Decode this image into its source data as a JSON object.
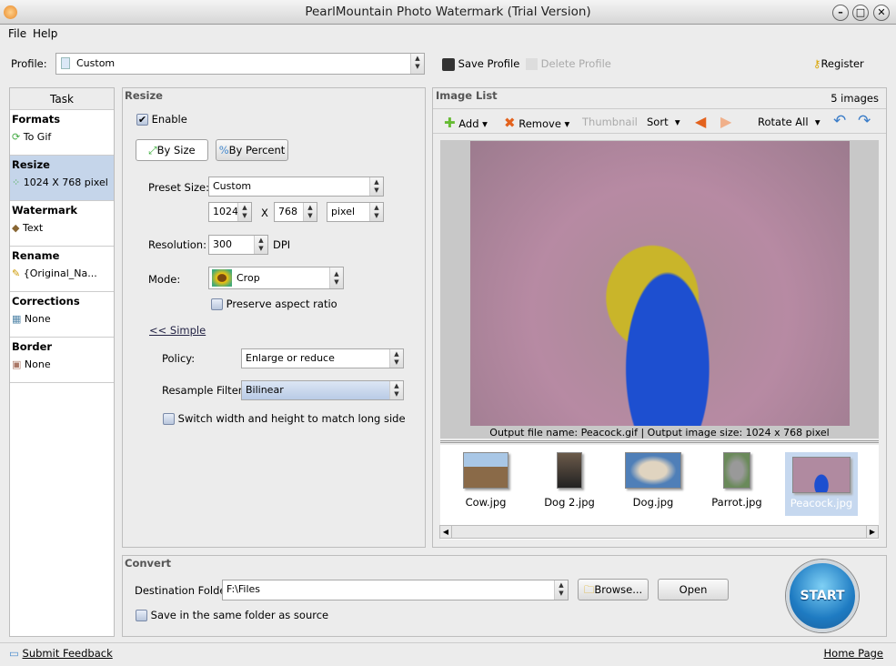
{
  "window": {
    "title": "PearlMountain Photo Watermark (Trial Version)"
  },
  "menu": [
    "File",
    "Help"
  ],
  "profile": {
    "label": "Profile:",
    "value": "Custom",
    "save": "Save Profile",
    "delete": "Delete Profile",
    "register": "Register"
  },
  "task": {
    "header": "Task",
    "sections": [
      {
        "title": "Formats",
        "value": "To Gif"
      },
      {
        "title": "Resize",
        "value": "1024 X 768 pixel"
      },
      {
        "title": "Watermark",
        "value": "Text"
      },
      {
        "title": "Rename",
        "value": "{Original_Na..."
      },
      {
        "title": "Corrections",
        "value": "None"
      },
      {
        "title": "Border",
        "value": "None"
      }
    ]
  },
  "resize": {
    "header": "Resize",
    "enable": "Enable",
    "by_size": "By Size",
    "by_percent": "By Percent",
    "preset_label": "Preset Size:",
    "preset": "Custom",
    "width": "1024",
    "x": "X",
    "height": "768",
    "unit": "pixel",
    "resolution_label": "Resolution:",
    "resolution": "300",
    "dpi": "DPI",
    "mode_label": "Mode:",
    "mode": "Crop",
    "preserve": "Preserve aspect ratio",
    "simple": "<< Simple",
    "policy_label": "Policy:",
    "policy": "Enlarge or reduce",
    "filter_label": "Resample Filter:",
    "filter": "Bilinear",
    "switch": "Switch width and height to match long side"
  },
  "imagelist": {
    "header": "Image List",
    "count": "5 images",
    "add": "Add",
    "remove": "Remove",
    "thumbnail": "Thumbnail",
    "sort": "Sort",
    "rotate_all": "Rotate All",
    "caption": "Output file name: Peacock.gif | Output image size: 1024 x 768 pixel",
    "thumbs": [
      "Cow.jpg",
      "Dog 2.jpg",
      "Dog.jpg",
      "Parrot.jpg",
      "Peacock.jpg"
    ]
  },
  "convert": {
    "header": "Convert",
    "dest_label": "Destination Folder:",
    "dest": "F:\\Files",
    "browse": "Browse...",
    "open": "Open",
    "same_folder": "Save in the same folder as source",
    "start": "START"
  },
  "status": {
    "feedback": "Submit Feedback",
    "home": "Home Page"
  }
}
